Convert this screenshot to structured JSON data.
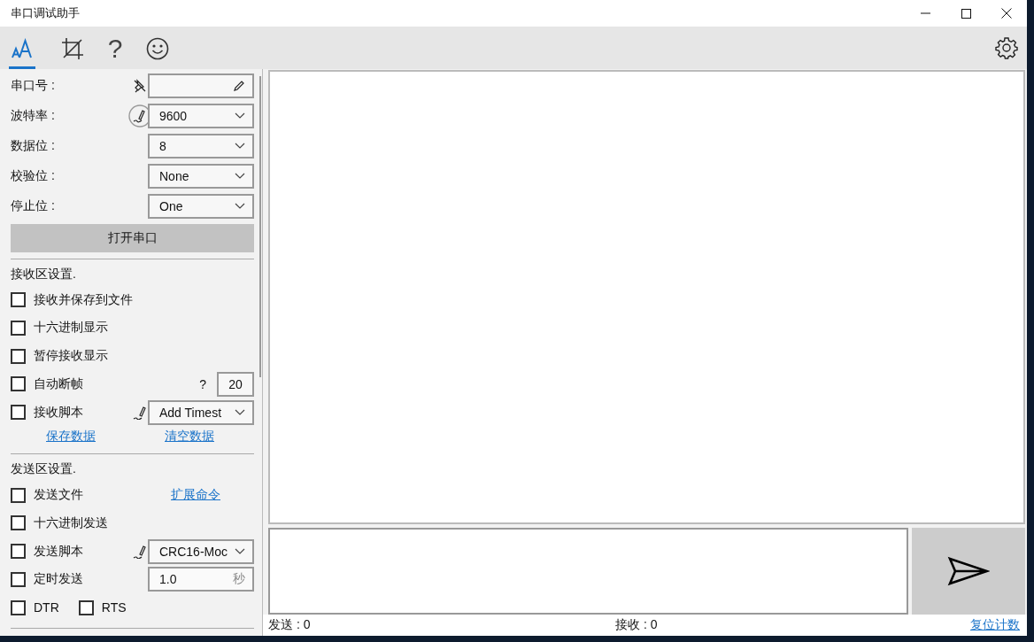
{
  "window": {
    "title": "串口调试助手"
  },
  "toolbar": {
    "tabs": [
      {
        "kind": "font",
        "selected": true
      },
      {
        "kind": "crop",
        "selected": false
      },
      {
        "kind": "help",
        "label": "?",
        "selected": false
      },
      {
        "kind": "smiley",
        "selected": false
      }
    ]
  },
  "port_settings": [
    {
      "label": "串口号 :",
      "kind": "input"
    },
    {
      "label": "波特率 :",
      "kind": "dropdown",
      "value": "9600"
    },
    {
      "label": "数据位 :",
      "kind": "dropdown",
      "value": "8"
    },
    {
      "label": "校验位 :",
      "kind": "dropdown",
      "value": "None"
    },
    {
      "label": "停止位 :",
      "kind": "dropdown",
      "value": "One"
    }
  ],
  "open_button": "打开串口",
  "receive_settings": {
    "title": "接收区设置.",
    "options": [
      {
        "kind": "plain",
        "label": "接收并保存到文件",
        "checked": false
      },
      {
        "kind": "plain",
        "label": "十六进制显示",
        "checked": false
      },
      {
        "kind": "plain",
        "label": "暂停接收显示",
        "checked": false
      },
      {
        "kind": "number",
        "label": "自动断帧",
        "checked": false,
        "hint": "?",
        "value": "20"
      },
      {
        "kind": "script",
        "label": "接收脚本",
        "checked": false,
        "value": "Add Timest"
      }
    ],
    "links": [
      "保存数据",
      "清空数据"
    ]
  },
  "send_settings": {
    "title": "发送区设置.",
    "options": [
      {
        "kind": "link",
        "label": "发送文件",
        "checked": false,
        "link": "扩展命令"
      },
      {
        "kind": "plain",
        "label": "十六进制发送",
        "checked": false
      },
      {
        "kind": "script",
        "label": "发送脚本",
        "checked": false,
        "value": "CRC16-Moc"
      },
      {
        "kind": "interval",
        "label": "定时发送",
        "checked": false,
        "value": "1.0",
        "unit": "秒"
      }
    ],
    "line_signals": [
      {
        "label": "DTR",
        "checked": false
      },
      {
        "label": "RTS",
        "checked": false
      }
    ]
  },
  "status_bar": {
    "sent": "发送 : 0",
    "received": "接收 : 0",
    "reset_link": "复位计数"
  }
}
